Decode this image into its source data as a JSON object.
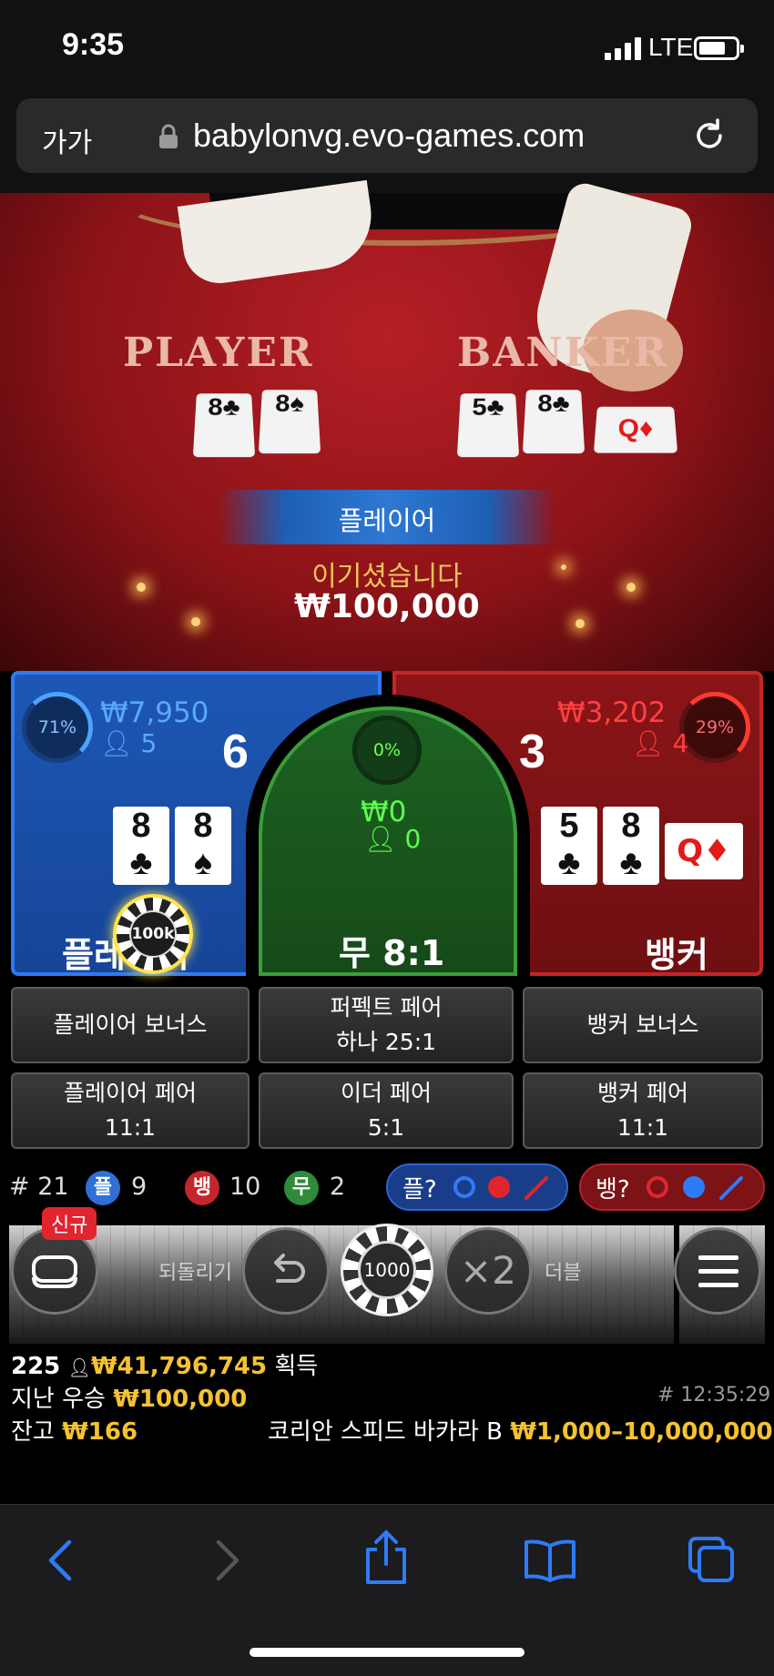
{
  "status": {
    "time": "9:35",
    "network": "LTE"
  },
  "browser": {
    "text_size": "가가",
    "url": "babylonvg.evo-games.com"
  },
  "video": {
    "felt_player": "PLAYER",
    "felt_banker": "BANKER",
    "player_cards": [
      "8♣",
      "8♠"
    ],
    "banker_cards": [
      "5♣",
      "8♣",
      "Q♦"
    ]
  },
  "result": {
    "side": "플레이어",
    "message": "이기셨습니다",
    "amount": "₩100,000"
  },
  "bets": {
    "player": {
      "percent": "71%",
      "amount": "₩7,950",
      "people": "5",
      "score": "6",
      "label": "플레이어",
      "cards": [
        {
          "v": "8",
          "s": "♣"
        },
        {
          "v": "8",
          "s": "♠"
        }
      ],
      "chip": "100k"
    },
    "tie": {
      "percent": "0%",
      "amount": "₩0",
      "people": "0",
      "label": "무 8:1"
    },
    "banker": {
      "percent": "29%",
      "amount": "₩3,202",
      "people": "4",
      "score": "3",
      "label": "뱅커",
      "cards": [
        {
          "v": "5",
          "s": "♣"
        },
        {
          "v": "8",
          "s": "♣"
        }
      ],
      "third_card": "Q♦"
    }
  },
  "side_bets": {
    "player_bonus": "플레이어 보너스",
    "perfect_pair": [
      "퍼펙트 페어",
      "하나 25:1"
    ],
    "banker_bonus": "뱅커 보너스",
    "player_pair": [
      "플레이어 페어",
      "11:1"
    ],
    "either_pair": [
      "이더 페어",
      "5:1"
    ],
    "banker_pair": [
      "뱅커 페어",
      "11:1"
    ]
  },
  "stats": {
    "round_count": "# 21",
    "player_tag": "플",
    "player_wins": "9",
    "banker_tag": "뱅",
    "banker_wins": "10",
    "tie_tag": "무",
    "tie_wins": "2",
    "predict_player": "플?",
    "predict_banker": "뱅?"
  },
  "controls": {
    "new_badge": "신규",
    "undo_label": "되돌리기",
    "chip_value": "1000",
    "double_symbol": "×2",
    "double_label": "더블"
  },
  "info": {
    "players": "225",
    "total_won": "₩41,796,745",
    "won_label": "획득",
    "last_win_label": "지난 우승",
    "last_win": "₩100,000",
    "round_id": "# 12:35:29",
    "balance_label": "잔고",
    "balance": "₩166",
    "table_name": "코리안 스피드 바카라 B",
    "limits": "₩1,000–10,000,000"
  },
  "colors": {
    "player": "#1d57b5",
    "banker": "#8b1518",
    "tie": "#1d6322",
    "gold": "#f5c232",
    "ios_blue": "#2f7bf6"
  }
}
